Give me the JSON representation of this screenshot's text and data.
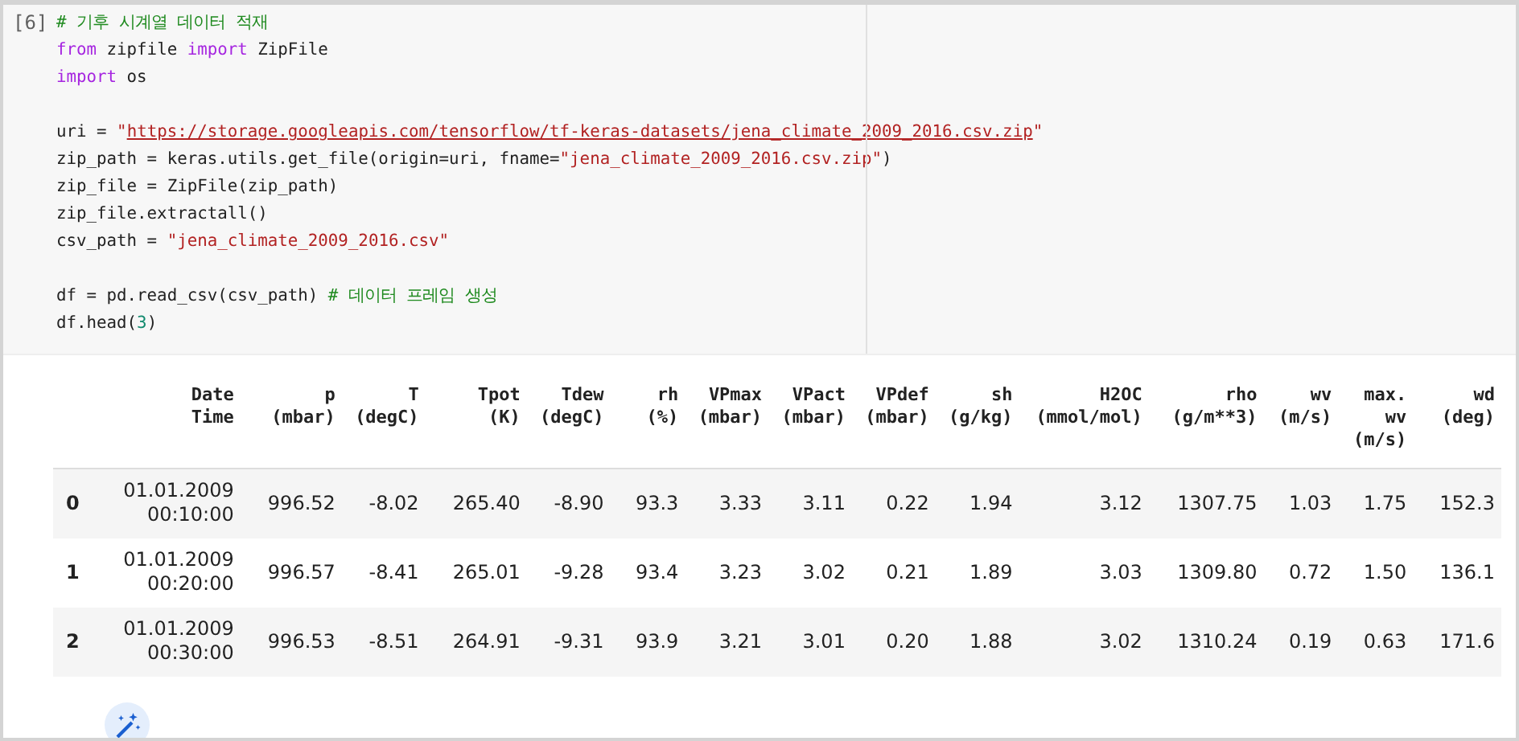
{
  "cell": {
    "execution_count": "[6]",
    "code_lines": [
      {
        "kind": "code",
        "tokens": [
          {
            "kind": "comment",
            "text": "# 기후 시계열 데이터 적재"
          }
        ]
      },
      {
        "kind": "code",
        "tokens": [
          {
            "kind": "keyword",
            "text": "from"
          },
          {
            "kind": "plain",
            "text": " zipfile "
          },
          {
            "kind": "keyword",
            "text": "import"
          },
          {
            "kind": "plain",
            "text": " ZipFile"
          }
        ]
      },
      {
        "kind": "code",
        "tokens": [
          {
            "kind": "keyword",
            "text": "import"
          },
          {
            "kind": "plain",
            "text": " os"
          }
        ]
      },
      {
        "kind": "blank"
      },
      {
        "kind": "code",
        "tokens": [
          {
            "kind": "plain",
            "text": "uri = "
          },
          {
            "kind": "string",
            "text": "\""
          },
          {
            "kind": "link",
            "text": "https://storage.googleapis.com/tensorflow/tf-keras-datasets/jena_climate_2009_2016.csv.zip"
          },
          {
            "kind": "string",
            "text": "\""
          }
        ]
      },
      {
        "kind": "code",
        "tokens": [
          {
            "kind": "plain",
            "text": "zip_path = keras.utils.get_file(origin=uri, fname="
          },
          {
            "kind": "string",
            "text": "\"jena_climate_2009_2016.csv.zip\""
          },
          {
            "kind": "plain",
            "text": ")"
          }
        ]
      },
      {
        "kind": "code",
        "tokens": [
          {
            "kind": "plain",
            "text": "zip_file = ZipFile(zip_path)"
          }
        ]
      },
      {
        "kind": "code",
        "tokens": [
          {
            "kind": "plain",
            "text": "zip_file.extractall()"
          }
        ]
      },
      {
        "kind": "code",
        "tokens": [
          {
            "kind": "plain",
            "text": "csv_path = "
          },
          {
            "kind": "string",
            "text": "\"jena_climate_2009_2016.csv\""
          }
        ]
      },
      {
        "kind": "blank"
      },
      {
        "kind": "code",
        "tokens": [
          {
            "kind": "plain",
            "text": "df = pd.read_csv(csv_path) "
          },
          {
            "kind": "comment",
            "text": "# 데이터 프레임 생성"
          }
        ]
      },
      {
        "kind": "code",
        "tokens": [
          {
            "kind": "plain",
            "text": "df.head("
          },
          {
            "kind": "number",
            "text": "3"
          },
          {
            "kind": "plain",
            "text": ")"
          }
        ]
      }
    ]
  },
  "table": {
    "columns": [
      {
        "lines": [
          "Date",
          "Time"
        ]
      },
      {
        "lines": [
          "p",
          "(mbar)"
        ]
      },
      {
        "lines": [
          "T",
          "(degC)"
        ]
      },
      {
        "lines": [
          "Tpot",
          "(K)"
        ]
      },
      {
        "lines": [
          "Tdew",
          "(degC)"
        ]
      },
      {
        "lines": [
          "rh",
          "(%)"
        ]
      },
      {
        "lines": [
          "VPmax",
          "(mbar)"
        ]
      },
      {
        "lines": [
          "VPact",
          "(mbar)"
        ]
      },
      {
        "lines": [
          "VPdef",
          "(mbar)"
        ]
      },
      {
        "lines": [
          "sh",
          "(g/kg)"
        ]
      },
      {
        "lines": [
          "H2OC",
          "(mmol/mol)"
        ]
      },
      {
        "lines": [
          "rho",
          "(g/m**3)"
        ]
      },
      {
        "lines": [
          "wv",
          "(m/s)"
        ]
      },
      {
        "lines": [
          "max.",
          "wv",
          "(m/s)"
        ]
      },
      {
        "lines": [
          "wd",
          "(deg)"
        ]
      }
    ],
    "rows": [
      {
        "index": "0",
        "cells": [
          [
            "01.01.2009",
            "00:10:00"
          ],
          "996.52",
          "-8.02",
          "265.40",
          "-8.90",
          "93.3",
          "3.33",
          "3.11",
          "0.22",
          "1.94",
          "3.12",
          "1307.75",
          "1.03",
          "1.75",
          "152.3"
        ]
      },
      {
        "index": "1",
        "cells": [
          [
            "01.01.2009",
            "00:20:00"
          ],
          "996.57",
          "-8.41",
          "265.01",
          "-9.28",
          "93.4",
          "3.23",
          "3.02",
          "0.21",
          "1.89",
          "3.03",
          "1309.80",
          "0.72",
          "1.50",
          "136.1"
        ]
      },
      {
        "index": "2",
        "cells": [
          [
            "01.01.2009",
            "00:30:00"
          ],
          "996.53",
          "-8.51",
          "264.91",
          "-9.31",
          "93.9",
          "3.21",
          "3.01",
          "0.20",
          "1.88",
          "3.02",
          "1310.24",
          "0.19",
          "0.63",
          "171.6"
        ]
      }
    ]
  }
}
